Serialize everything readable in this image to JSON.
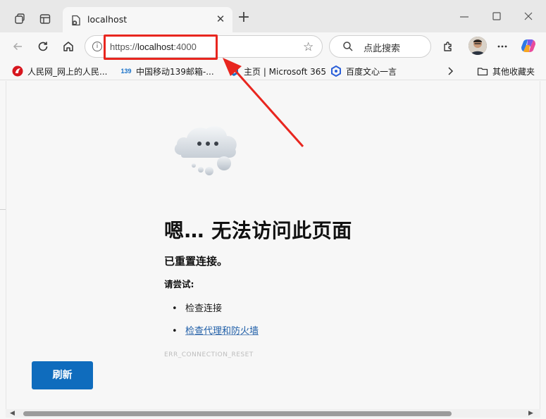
{
  "tab": {
    "title": "localhost",
    "close_glyph": "✕"
  },
  "newtab_glyph": "+",
  "address": {
    "scheme": "https://",
    "host": "localhost",
    "port": ":4000",
    "info_glyph": "i"
  },
  "search": {
    "label": "点此搜索"
  },
  "bookmarks": [
    {
      "label": "人民网_网上的人民...",
      "icon": "renminwang-icon"
    },
    {
      "label": "中国移动139邮箱-...",
      "icon": "mail139-icon"
    },
    {
      "label": "主页 | Microsoft 365",
      "icon": "microsoft365-icon"
    },
    {
      "label": "百度文心一言",
      "icon": "wenxin-icon"
    }
  ],
  "bookmarks_more": "其他收藏夹",
  "favicon_badge": "139",
  "error": {
    "headline": "嗯… 无法访问此页面",
    "subhead": "已重置连接。",
    "try_label": "请尝试:",
    "bullet": "•",
    "items": [
      "检查连接",
      "检查代理和防火墙"
    ],
    "code": "ERR_CONNECTION_RESET",
    "refresh_label": "刷新"
  },
  "colors": {
    "accent": "#0f6cbd",
    "annotation": "#e8261f",
    "link": "#1e5ea8"
  }
}
